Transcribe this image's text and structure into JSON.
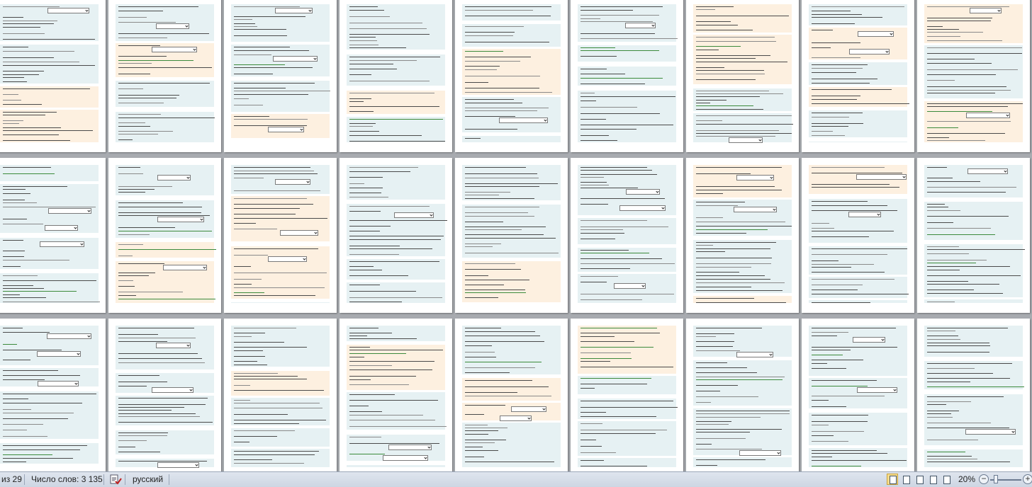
{
  "window": {
    "app": "Microsoft Word",
    "view": "print-layout multi-page, zoom 20%"
  },
  "document": {
    "page_count": 29,
    "rows_visible": 3,
    "pages_per_row": 9,
    "page_colors": {
      "question_block": "#e6f1f3",
      "feedback_block": "#fdf0e0",
      "canvas": "#a8abb0"
    }
  },
  "statusbar": {
    "page_info": "из 29",
    "word_count": "Число слов: 3 135",
    "language_icon": "spell-check-icon",
    "language": "русский",
    "zoom_level": "20%",
    "zoom_out_label": "−",
    "zoom_in_label": "+",
    "zoom_fraction": 0.12,
    "views": [
      {
        "name": "print-layout",
        "active": true
      },
      {
        "name": "full-screen-reading",
        "active": false
      },
      {
        "name": "web-layout",
        "active": false
      },
      {
        "name": "outline",
        "active": false
      },
      {
        "name": "draft",
        "active": false
      }
    ]
  }
}
